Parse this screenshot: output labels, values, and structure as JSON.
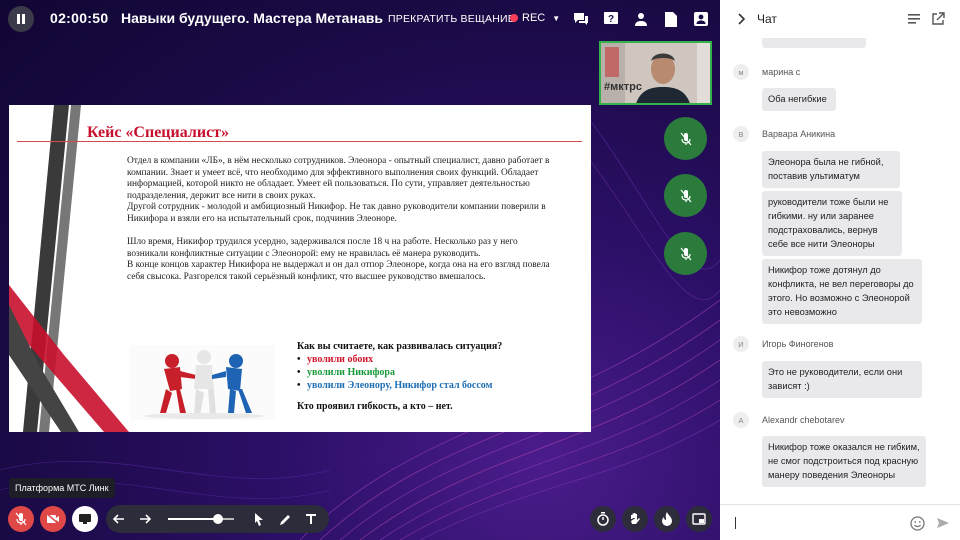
{
  "header": {
    "timer": "02:00:50",
    "title": "Навыки будущего. Мастера Метанавь",
    "stop_broadcast": "ПРЕКРАТИТЬ ВЕЩАНИЕ",
    "rec_label": "REC"
  },
  "video": {
    "self_overlay_text": "#мктрс"
  },
  "slide": {
    "title": "Кейс «Специалист»",
    "paragraphs": [
      "Отдел в компании «ЛБ», в нём несколько сотрудников. Элеонора - опытный специалист, давно работает в компании. Знает и умеет всё, что необходимо для эффективного выполнения своих функций. Обладает информацией, которой никто не обладает. Умеет ей пользоваться. По сути, управляет деятельностью подразделения, держит все нити в своих руках.",
      "Другой сотрудник - молодой и амбициозный Никифор. Не так давно руководители компании поверили в Никифора и взяли его на испытательный срок, подчинив Элеоноре.",
      "Шло время, Никифор трудился усердно, задерживался после 18 ч на работе. Несколько раз у него возникали конфликтные ситуации с Элеонорой: ему не нравилась её манера руководить.",
      "В конце концов характер Никифора не выдержал и он дал отпор Элеоноре, когда она на его взгляд повела себя свысока. Разгорелся такой серьёзный конфликт, что высшее руководство вмешалось."
    ],
    "question": "Как вы считаете, как развивалась ситуация?",
    "options": [
      {
        "text": "уволили обоих",
        "color": "#d0162b"
      },
      {
        "text": "уволили Никифора",
        "color": "#1a9a3b"
      },
      {
        "text": "уволили Элеонору, Никифор стал боссом",
        "color": "#1e6fb4"
      }
    ],
    "final_question": "Кто проявил гибкость, а кто – нет."
  },
  "tooltip": "Платформа МТС Линк",
  "toolbar": {
    "zoom_value": 0.75
  },
  "chat": {
    "title": "Чат",
    "messages": [
      {
        "author": "марина с",
        "initial": "м",
        "texts": [
          "Оба негибкие"
        ]
      },
      {
        "author": "Варвара Аникина",
        "initial": "В",
        "texts": [
          "Элеонора была не гибной, поставив ультиматум",
          "руководители тоже были не гибкими. ну или заранее подстраховались, вернув себе все нити Элеоноры",
          "Никифор тоже дотянул до конфликта, не вел переговоры до этого. Но возможно с Элеонорой это невозможно"
        ]
      },
      {
        "author": "Игорь Финогенов",
        "initial": "И",
        "texts": [
          "Это не руководители, если они зависят :)"
        ]
      },
      {
        "author": "Alexandr chebotarev",
        "initial": "A",
        "texts": [
          "Никифор тоже оказался не гибким, не смог подстроиться под красную манеру поведения Элеоноры"
        ]
      }
    ]
  },
  "colors": {
    "accent_green": "#2b7b3d",
    "rec_red": "#ff3d57",
    "muted_red": "#e04848"
  }
}
